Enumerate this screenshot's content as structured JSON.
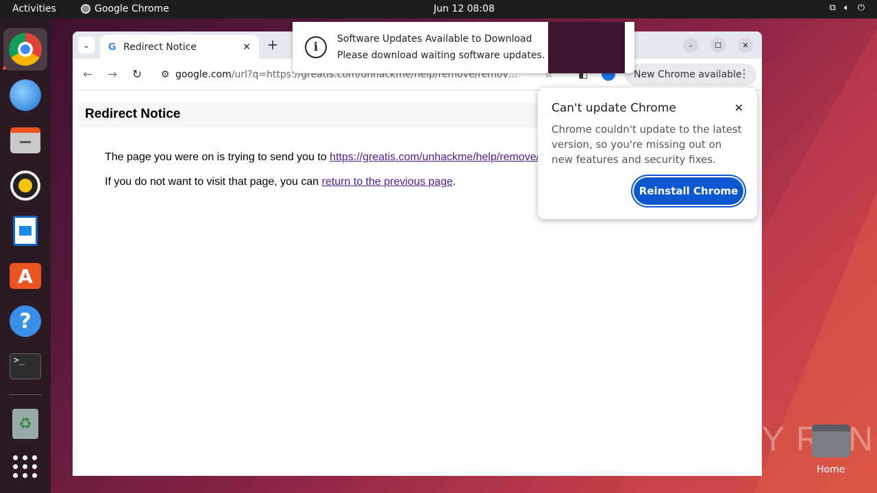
{
  "topbar": {
    "activities": "Activities",
    "app_name": "Google Chrome",
    "clock": "Jun 12  08:08",
    "tray_icons": [
      "network-icon",
      "volume-icon",
      "power-icon"
    ]
  },
  "dock": {
    "items": [
      "google-chrome",
      "thunderbird",
      "files",
      "rhythmbox",
      "libreoffice-writer",
      "app-center",
      "help",
      "terminal",
      "trash",
      "show-apps"
    ],
    "terminal_prompt": ">_"
  },
  "browser": {
    "tab": {
      "favicon": "G",
      "title": "Redirect Notice"
    },
    "url_host": "google.com",
    "url_path": "/url?q=https://greatis.com/unhackme/help/remove/remove-oveleoliu...",
    "update_chip": "New Chrome available"
  },
  "page": {
    "heading": "Redirect Notice",
    "line1_text": "The page you were on is trying to send you to ",
    "line1_link": "https://greatis.com/unhackme/help/remove/",
    "line2_text": "If you do not want to visit that page, you can ",
    "line2_link": "return to the previous page",
    "line2_end": "."
  },
  "popup": {
    "title": "Can't update Chrome",
    "body": "Chrome couldn't update to the latest version, so you're missing out on new features and security fixes.",
    "button": "Reinstall Chrome"
  },
  "notification": {
    "title": "Software Updates Available to Download",
    "body": "Please download waiting software updates."
  },
  "desktop": {
    "watermark": "ANY RUN",
    "home_label": "Home"
  },
  "colors": {
    "accent": "#0b57d0",
    "ubuntu_orange": "#e95420",
    "link_visited": "#551a8b"
  }
}
